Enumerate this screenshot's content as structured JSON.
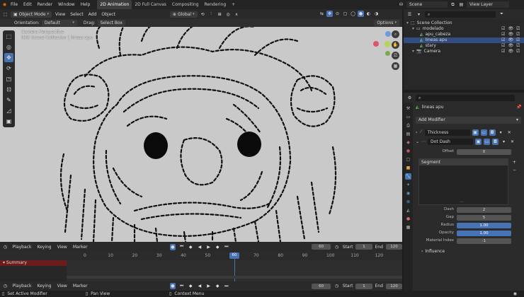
{
  "topbar": {
    "menus": [
      "File",
      "Edit",
      "Render",
      "Window",
      "Help"
    ],
    "tabs": [
      "2D Animation",
      "2D Full Canvas",
      "Compositing",
      "Rendering"
    ],
    "add_tab": "+",
    "scene": "Scene",
    "view_layer": "View Layer"
  },
  "viewport_header": {
    "mode": "Object Mode",
    "menus": [
      "View",
      "Select",
      "Add",
      "Object"
    ],
    "transform": "Global"
  },
  "viewport_header2": {
    "orientation_label": "Orientation:",
    "orientation_value": "Default",
    "drag_label": "Drag:",
    "drag_value": "Select Box",
    "options": "Options"
  },
  "viewport": {
    "camera_title": "Camera Perspective",
    "camera_sub": "(60) Scene Collection | lineas apu"
  },
  "outliner": {
    "items": [
      {
        "label": "Scene Collection",
        "level": 0
      },
      {
        "label": "modelado",
        "level": 1
      },
      {
        "label": "apu_cabeza",
        "level": 2
      },
      {
        "label": "lineas apu",
        "level": 2
      },
      {
        "label": "stary",
        "level": 2
      },
      {
        "label": "Camera",
        "level": 1
      }
    ]
  },
  "properties": {
    "object_name": "lineas apu",
    "add_modifier": "Add Modifier",
    "modifiers": [
      "Thickness",
      "Dot Dash"
    ],
    "offset_label": "Offset",
    "offset_value": "0",
    "segment_header": "Segment",
    "dash_label": "Dash",
    "dash_value": "2",
    "gap_label": "Gap",
    "gap_value": "5",
    "radius_label": "Radius",
    "radius_value": "1.00",
    "opacity_label": "Opacity",
    "opacity_value": "1.00",
    "material_label": "Material Index",
    "material_value": "-1",
    "influence": "Influence"
  },
  "timeline": {
    "menus": [
      "Playback",
      "Keying",
      "View",
      "Marker"
    ],
    "current_frame": "60",
    "start_label": "Start",
    "start_value": "1",
    "end_label": "End",
    "end_value": "120",
    "ticks": [
      "0",
      "10",
      "20",
      "30",
      "40",
      "50",
      "60",
      "70",
      "80",
      "90",
      "100",
      "110",
      "120"
    ],
    "summary": "Summary"
  },
  "timeline2": {
    "menus": [
      "Playback",
      "Keying",
      "View",
      "Marker"
    ],
    "current_frame": "60",
    "start_label": "Start",
    "start_value": "1",
    "end_label": "End",
    "end_value": "120"
  },
  "status": {
    "items": [
      "Set Active Modifier",
      "Pan View",
      "Context Menu"
    ]
  },
  "colors": {
    "accent": "#4772b3",
    "playhead": "#4772b3",
    "summary": "#6b1d1d"
  }
}
